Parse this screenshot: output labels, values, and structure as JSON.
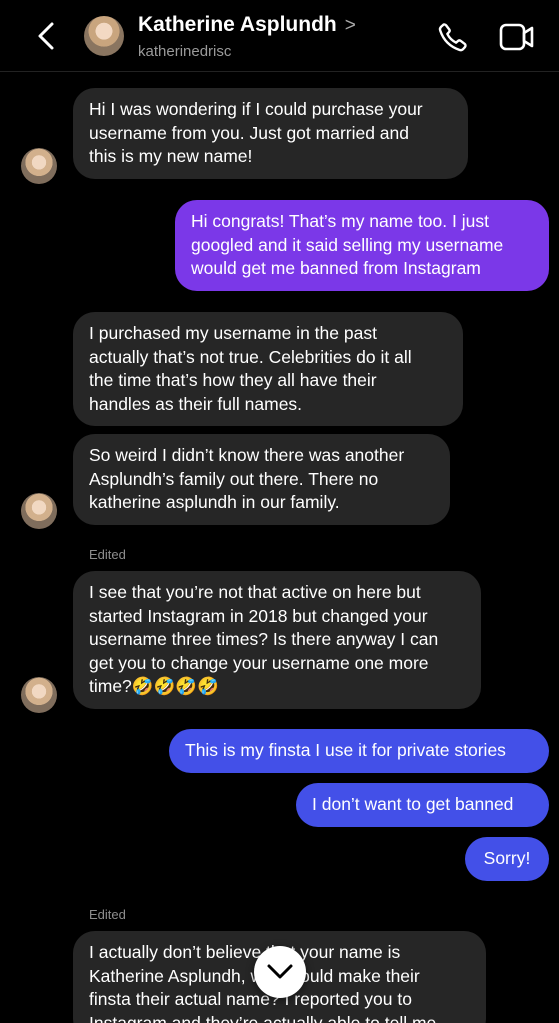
{
  "header": {
    "contact_name": "Katherine Asplundh",
    "username": "katherinedrisc",
    "name_chevron": ">"
  },
  "messages": [
    {
      "lines": [
        "Hi I was wondering if I could purchase your",
        "username from you. Just got married and",
        "this is my new name!"
      ]
    },
    {
      "lines": [
        "Hi congrats! That’s my name too. I just",
        "googled and it said selling my username",
        "would get me banned from Instagram"
      ]
    },
    {
      "lines": [
        "I purchased my username in the past",
        "actually that’s not true. Celebrities do it all",
        "the time that’s how they all have their",
        "handles as their full names."
      ]
    },
    {
      "lines": [
        "So weird I didn’t know there was another",
        "Asplundh’s family out there. There no",
        "katherine asplundh in our family."
      ]
    },
    {
      "lines": [
        "I see that you’re not that active on here but",
        "started Instagram in 2018 but changed your",
        "username three times? Is there anyway I can",
        "get you to change your username one more",
        "time?🤣🤣🤣🤣"
      ]
    },
    {
      "lines": [
        "This is my finsta I use it for private stories"
      ]
    },
    {
      "lines": [
        "I don’t want to get banned"
      ]
    },
    {
      "lines": [
        "Sorry!"
      ]
    },
    {
      "lines": [
        "I actually don’t believe that your name is",
        "Katherine Asplundh, who would make their",
        "finsta their actual name? I reported you to",
        "Instagram and they’re actually able to tell me"
      ]
    }
  ],
  "edited_labels": [
    "Edited",
    "Edited"
  ],
  "icons": {
    "back": "chevron-left-icon",
    "call": "phone-icon",
    "video": "video-camera-icon",
    "scroll": "chevron-down-icon"
  },
  "colors": {
    "received_bubble": "#262626",
    "sent_purple": "#7b38e8",
    "sent_blue": "#4350e8",
    "background": "#000000"
  }
}
